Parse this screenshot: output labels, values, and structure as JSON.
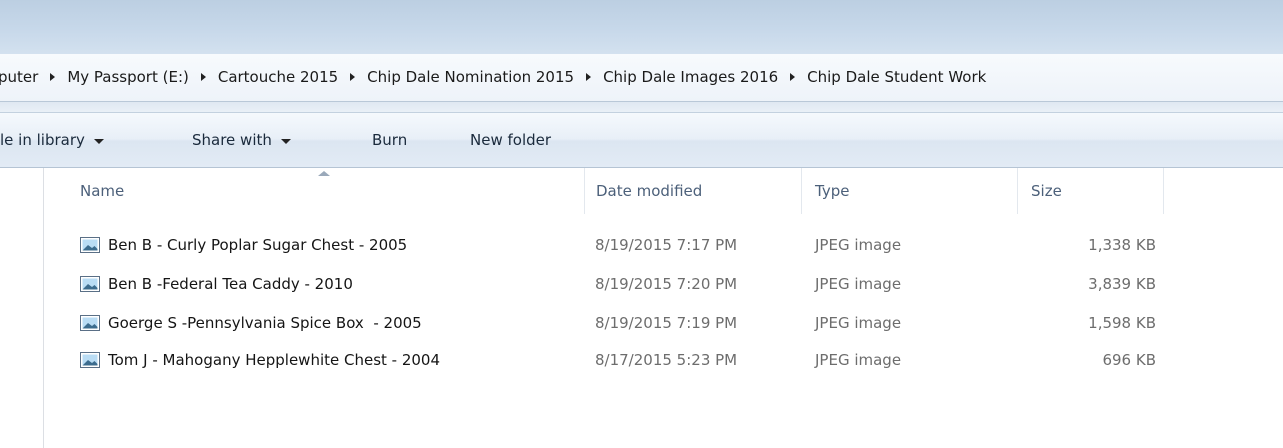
{
  "address_bar": {
    "crumbs": [
      "puter",
      "My Passport (E:)",
      "Cartouche 2015",
      "Chip Dale Nomination 2015",
      "Chip Dale Images 2016",
      "Chip Dale Student Work"
    ]
  },
  "toolbar": {
    "include_in_library": "le in library",
    "share_with": "Share with",
    "burn": "Burn",
    "new_folder": "New folder"
  },
  "columns": {
    "name": "Name",
    "date_modified": "Date modified",
    "type": "Type",
    "size": "Size"
  },
  "files": [
    {
      "name": "Ben B - Curly Poplar Sugar Chest - 2005",
      "date": "8/19/2015 7:17 PM",
      "type": "JPEG image",
      "size": "1,338 KB",
      "icon": "jpeg-image-icon"
    },
    {
      "name": "Ben B -Federal Tea Caddy - 2010",
      "date": "8/19/2015 7:20 PM",
      "type": "JPEG image",
      "size": "3,839 KB",
      "icon": "jpeg-image-icon"
    },
    {
      "name": "Goerge S -Pennsylvania Spice Box  - 2005",
      "date": "8/19/2015 7:19 PM",
      "type": "JPEG image",
      "size": "1,598 KB",
      "icon": "jpeg-image-icon"
    },
    {
      "name": "Tom J - Mahogany Hepplewhite Chest - 2004",
      "date": "8/17/2015 5:23 PM",
      "type": "JPEG image",
      "size": "696 KB",
      "icon": "jpeg-image-icon"
    }
  ],
  "colors": {
    "chrome_top": "#c7d8ea",
    "toolbar": "#e8eff7",
    "header_text": "#4c607a",
    "secondary_text": "#6d6d6d"
  }
}
